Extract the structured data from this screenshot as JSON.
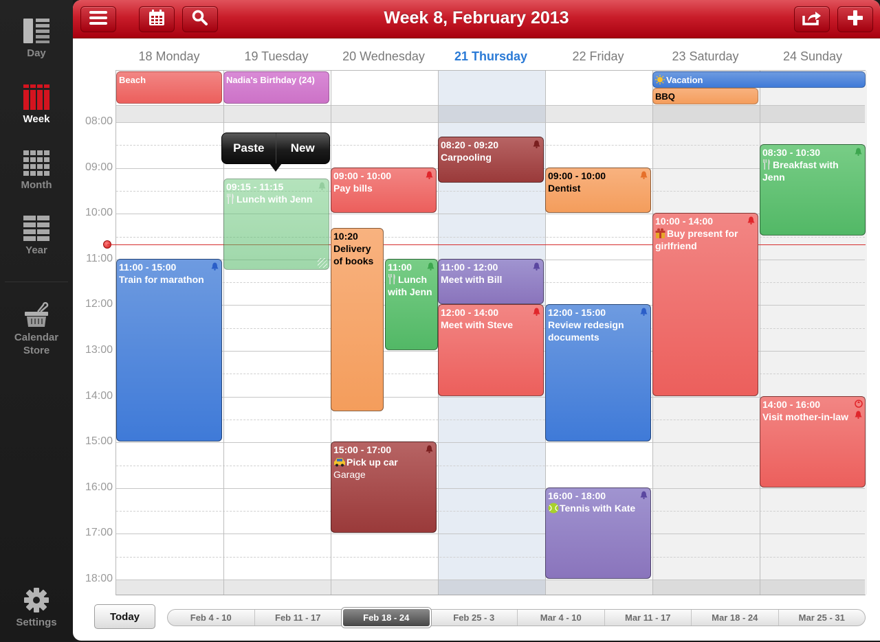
{
  "sidebar": {
    "items": [
      {
        "label": "Day",
        "icon": "day-view-icon",
        "active": false
      },
      {
        "label": "Week",
        "icon": "week-view-icon",
        "active": true
      },
      {
        "label": "Month",
        "icon": "month-view-icon",
        "active": false
      },
      {
        "label": "Year",
        "icon": "year-view-icon",
        "active": false
      },
      {
        "label": "Calendar Store",
        "icon": "basket-icon",
        "active": false
      }
    ],
    "settings_label": "Settings"
  },
  "toolbar": {
    "title": "Week 8, February 2013",
    "left_buttons": [
      "menu-icon",
      "calendar-icon",
      "search-icon"
    ],
    "right_buttons": [
      "share-icon",
      "plus-icon"
    ]
  },
  "days": [
    {
      "label": "18 Monday",
      "today": false
    },
    {
      "label": "19 Tuesday",
      "today": false
    },
    {
      "label": "20 Wednesday",
      "today": false
    },
    {
      "label": "21 Thursday",
      "today": true
    },
    {
      "label": "22 Friday",
      "today": false
    },
    {
      "label": "23 Saturday",
      "today": false
    },
    {
      "label": "24 Sunday",
      "today": false
    }
  ],
  "hours": [
    "08:00",
    "09:00",
    "10:00",
    "11:00",
    "12:00",
    "13:00",
    "14:00",
    "15:00",
    "16:00",
    "17:00",
    "18:00"
  ],
  "all_day_events": [
    {
      "title": "Beach",
      "day": 0,
      "span": 1,
      "row": 0,
      "color": "red"
    },
    {
      "title": "Nadia's Birthday (24)",
      "day": 1,
      "span": 1,
      "row": 0,
      "color": "pink"
    },
    {
      "title": "Vacation",
      "day": 5,
      "span": 2,
      "row": 0,
      "color": "blue",
      "icon": "sun-icon"
    },
    {
      "title": "BBQ",
      "day": 5,
      "span": 1,
      "row": 1,
      "color": "orange"
    }
  ],
  "events": [
    {
      "time": "11:00 - 15:00",
      "title": "Train for marathon",
      "day": 0,
      "start": 11,
      "end": 15,
      "color": "blue",
      "bell": true
    },
    {
      "time": "09:15 - 11:15",
      "title": "Lunch with Jenn",
      "day": 1,
      "start": 9.25,
      "end": 11.25,
      "color": "green",
      "bell": true,
      "icon": "fork-knife-icon",
      "ghost": true
    },
    {
      "time": "09:00 - 10:00",
      "title": "Pay bills",
      "day": 2,
      "start": 9,
      "end": 10,
      "color": "red",
      "bell": true
    },
    {
      "time": "10:20",
      "title": "Delivery of books",
      "day": 2,
      "start": 10.33,
      "end": 14.33,
      "color": "orange",
      "dark": true,
      "col": 0,
      "cols": 2
    },
    {
      "time": "11:00",
      "title": "Lunch with Jenn",
      "day": 2,
      "start": 11,
      "end": 13,
      "color": "green",
      "bell": true,
      "icon": "fork-knife-icon",
      "col": 1,
      "cols": 2
    },
    {
      "time": "15:00 - 17:00",
      "title": "Pick up car",
      "location": "Garage",
      "day": 2,
      "start": 15,
      "end": 17,
      "color": "maroon",
      "bell": true,
      "icon": "car-icon"
    },
    {
      "time": "08:20 - 09:20",
      "title": "Carpooling",
      "day": 3,
      "start": 8.33,
      "end": 9.33,
      "color": "maroon",
      "bell": true
    },
    {
      "time": "11:00 - 12:00",
      "title": "Meet with Bill",
      "day": 3,
      "start": 11,
      "end": 12,
      "color": "purple",
      "bell": true
    },
    {
      "time": "12:00 - 14:00",
      "title": "Meet with Steve",
      "day": 3,
      "start": 12,
      "end": 14,
      "color": "red",
      "bell": true
    },
    {
      "time": "09:00 - 10:00",
      "title": "Dentist",
      "day": 4,
      "start": 9,
      "end": 10,
      "color": "orange",
      "bell": true,
      "dark": true
    },
    {
      "time": "12:00 - 15:00",
      "title": "Review redesign documents",
      "day": 4,
      "start": 12,
      "end": 15,
      "color": "blue",
      "bell": true
    },
    {
      "time": "16:00 - 18:00",
      "title": "Tennis with Kate",
      "day": 4,
      "start": 16,
      "end": 18,
      "color": "purple",
      "bell": true,
      "icon": "tennis-ball-icon"
    },
    {
      "time": "10:00 - 14:00",
      "title": "Buy present for girlfriend",
      "day": 5,
      "start": 10,
      "end": 14,
      "color": "red",
      "bell": true,
      "icon": "gift-icon"
    },
    {
      "time": "08:30 - 10:30",
      "title": "Breakfast with Jenn",
      "day": 6,
      "start": 8.5,
      "end": 10.5,
      "color": "green",
      "bell": true,
      "icon": "fork-knife-icon"
    },
    {
      "time": "14:00 - 16:00",
      "title": "Visit mother-in-law",
      "day": 6,
      "start": 14,
      "end": 16,
      "color": "red",
      "bell": true,
      "recurring": true
    }
  ],
  "popup": {
    "paste_label": "Paste",
    "new_label": "New"
  },
  "now_time": "10:41",
  "bottom": {
    "today_label": "Today",
    "weeks": [
      "Feb 4 - 10",
      "Feb 11 - 17",
      "Feb 18 - 24",
      "Feb 25 - 3",
      "Mar 4 - 10",
      "Mar 11 - 17",
      "Mar 18 - 24",
      "Mar 25 - 31"
    ],
    "selected_week": 2
  },
  "colors": {
    "accent_red": "#c91d2a",
    "today_blue": "#2a7ad6",
    "today_column": "#e6ecf4"
  }
}
